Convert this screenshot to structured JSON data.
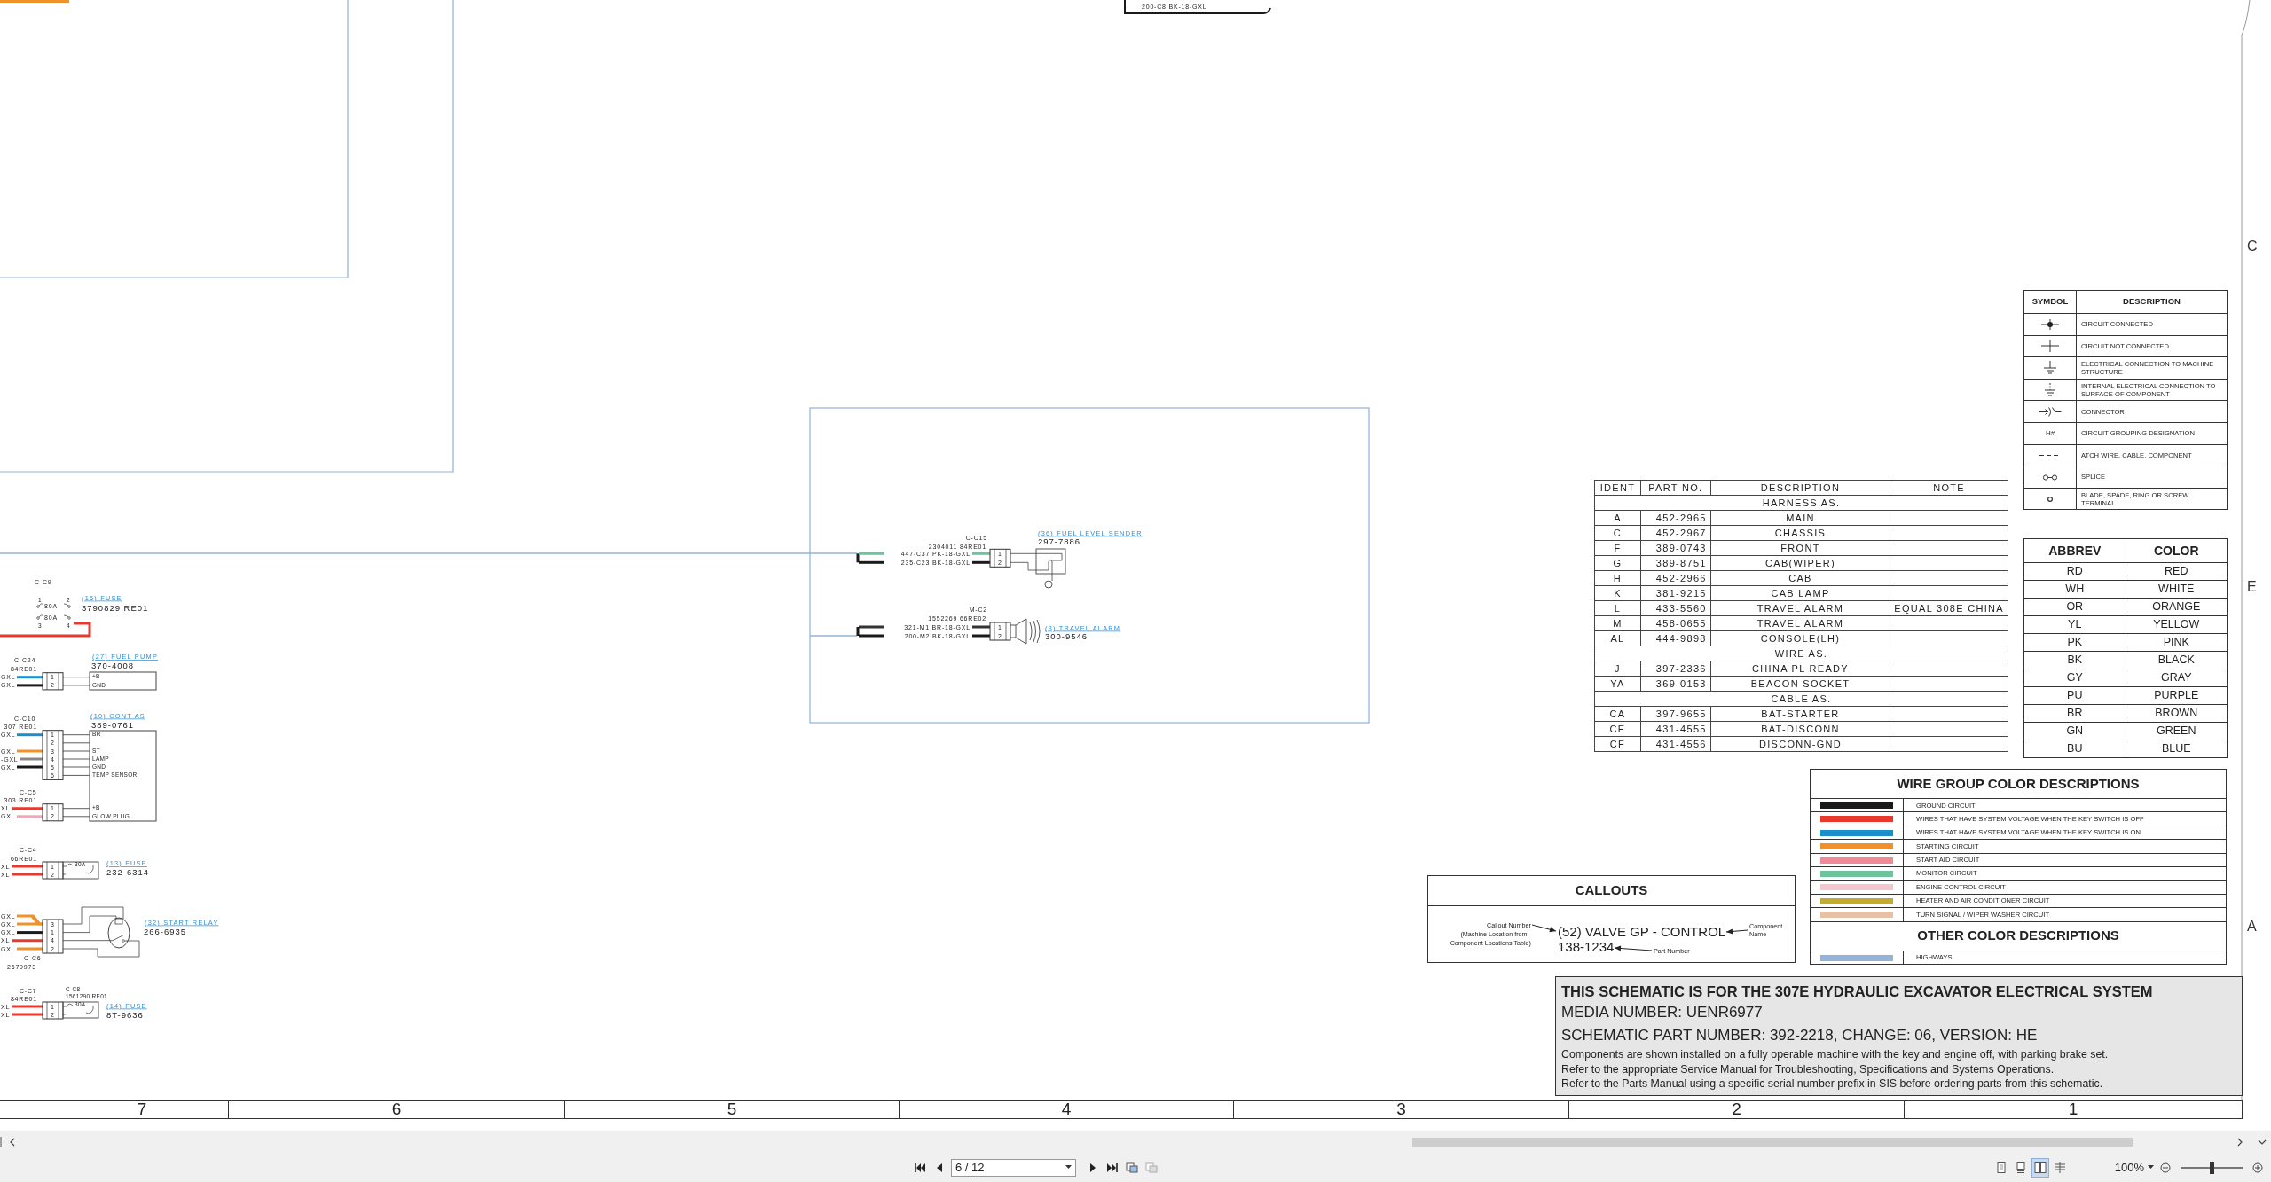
{
  "schematic": {
    "top_wire_label": "200-C8 BK-18-GXL",
    "components": [
      {
        "kind": "fuse_pair",
        "connector": "C-C9",
        "pins": [
          "1",
          "2",
          "3",
          "4"
        ],
        "ratings": [
          "80A",
          "80A"
        ],
        "color": "#e8392c",
        "callout": "(15) FUSE",
        "part": "3790829 RE01"
      },
      {
        "kind": "module",
        "connectors": [
          {
            "id": "C-C24",
            "ref": "84RE01",
            "pins": [
              {
                "n": "1",
                "wire": "GXL",
                "color": "#1a8fc9",
                "function": "+B"
              },
              {
                "n": "2",
                "wire": "GXL",
                "color": "#1a1a1a",
                "function": "GND"
              }
            ]
          }
        ],
        "callout": "(27) FUEL PUMP",
        "part": "370-4008"
      },
      {
        "kind": "module",
        "connectors": [
          {
            "id": "C-C10",
            "ref": "307 RE01",
            "pins": [
              {
                "n": "1",
                "wire": "GXL",
                "color": "#1a8fc9",
                "function": "BR"
              },
              {
                "n": "2"
              },
              {
                "n": "3",
                "wire": "GXL",
                "color": "#f0912a",
                "function": "ST"
              },
              {
                "n": "4",
                "wire": "-GXL",
                "color": "#888888",
                "function": "LAMP"
              },
              {
                "n": "5",
                "wire": "GXL",
                "color": "#1a1a1a",
                "function": "GND"
              },
              {
                "n": "6",
                "function": "TEMP SENSOR"
              }
            ]
          },
          {
            "id": "C-C5",
            "ref": "303 RE01",
            "pins": [
              {
                "n": "1",
                "wire": "XL",
                "color": "#e8392c",
                "function": "+B"
              },
              {
                "n": "2",
                "wire": "GXL",
                "color": "#f3a7b4",
                "function": "GLOW PLUG"
              }
            ]
          }
        ],
        "callout": "(10) CONT AS",
        "part": "389-0761"
      },
      {
        "kind": "fuse",
        "connector": "C-C4",
        "ref": "66RE01",
        "pins": [
          {
            "n": "1",
            "wire": "XL",
            "color": "#e8392c"
          },
          {
            "n": "2",
            "wire": "XL",
            "color": "#e8392c"
          }
        ],
        "rating": "30A",
        "callout": "(13) FUSE",
        "part": "232-6314"
      },
      {
        "kind": "relay",
        "connector": "C-C6",
        "ref": "2679973",
        "wires": [
          {
            "label": "GXL",
            "color": "#f0912a"
          },
          {
            "label": "GXL",
            "color": "#f0912a"
          },
          {
            "label": "GXL",
            "color": "#1a1a1a"
          },
          {
            "label": "XL",
            "color": "#e8392c"
          },
          {
            "label": "GXL",
            "color": "#f0912a"
          }
        ],
        "pins": [
          "3",
          "1",
          "4",
          "2"
        ],
        "callout": "(32) START RELAY",
        "part": "266-6935"
      },
      {
        "kind": "fuse",
        "connector": "C-C7",
        "ref": "84RE01",
        "pins": [
          {
            "n": "1",
            "wire": "XL",
            "color": "#e8392c"
          },
          {
            "n": "2",
            "wire": "XL",
            "color": "#e8392c"
          }
        ],
        "rating": "30A",
        "plug": "C-C8",
        "plug_ref": "1561290 RE01",
        "callout": "(14) FUSE",
        "part": "8T-9636"
      },
      {
        "kind": "sender",
        "connector": "C-C15",
        "ref": "2304011 84RE01",
        "pins": [
          {
            "n": "1",
            "wire": "447-C37 PK-18-GXL",
            "color": "#6dc39b"
          },
          {
            "n": "2",
            "wire": "235-C23 BK-18-GXL",
            "color": "#1a1a1a"
          }
        ],
        "callout": "(36) FUEL LEVEL SENDER",
        "part": "297-7886"
      },
      {
        "kind": "alarm",
        "connector": "M-C2",
        "ref": "1552269 66RE02",
        "pins": [
          {
            "n": "1",
            "wire": "321-M1 BR-18-GXL",
            "color": "#333333"
          },
          {
            "n": "2",
            "wire": "200-M2 BK-18-GXL",
            "color": "#1a1a1a"
          }
        ],
        "callout": "(3) TRAVEL ALARM",
        "part": "300-9546"
      }
    ]
  },
  "parts_table": {
    "columns": [
      "IDENT",
      "PART NO.",
      "DESCRIPTION",
      "NOTE"
    ],
    "rows": [
      {
        "kind": "section",
        "title": "HARNESS AS."
      },
      {
        "kind": "part",
        "ident": "A",
        "part_no": "452-2965",
        "description": "MAIN"
      },
      {
        "kind": "part",
        "ident": "C",
        "part_no": "452-2967",
        "description": "CHASSIS"
      },
      {
        "kind": "part",
        "ident": "F",
        "part_no": "389-0743",
        "description": "FRONT"
      },
      {
        "kind": "part",
        "ident": "G",
        "part_no": "389-8751",
        "description": "CAB(WIPER)"
      },
      {
        "kind": "part",
        "ident": "H",
        "part_no": "452-2966",
        "description": "CAB"
      },
      {
        "kind": "part",
        "ident": "K",
        "part_no": "381-9215",
        "description": "CAB LAMP"
      },
      {
        "kind": "part",
        "ident": "L",
        "part_no": "433-5560",
        "description": "TRAVEL ALARM",
        "note": "EQUAL 308E CHINA"
      },
      {
        "kind": "part",
        "ident": "M",
        "part_no": "458-0655",
        "description": "TRAVEL ALARM"
      },
      {
        "kind": "part",
        "ident": "AL",
        "part_no": "444-9898",
        "description": "CONSOLE(LH)"
      },
      {
        "kind": "section",
        "title": "WIRE AS."
      },
      {
        "kind": "part",
        "ident": "J",
        "part_no": "397-2336",
        "description": "CHINA PL READY"
      },
      {
        "kind": "part",
        "ident": "YA",
        "part_no": "369-0153",
        "description": "BEACON SOCKET"
      },
      {
        "kind": "section",
        "title": "CABLE AS."
      },
      {
        "kind": "part",
        "ident": "CA",
        "part_no": "397-9655",
        "description": "BAT-STARTER"
      },
      {
        "kind": "part",
        "ident": "CE",
        "part_no": "431-4555",
        "description": "BAT-DISCONN"
      },
      {
        "kind": "part",
        "ident": "CF",
        "part_no": "431-4556",
        "description": "DISCONN-GND"
      }
    ]
  },
  "symbol_table": {
    "columns": [
      "SYMBOL",
      "DESCRIPTION"
    ],
    "rows": [
      {
        "kind": "connected",
        "description": "CIRCUIT CONNECTED"
      },
      {
        "kind": "crossing",
        "description": "CIRCUIT NOT CONNECTED"
      },
      {
        "kind": "ground",
        "description": "ELECTRICAL CONNECTION TO MACHINE STRUCTURE"
      },
      {
        "kind": "internal_ground",
        "description": "INTERNAL ELECTRICAL CONNECTION TO SURFACE OF COMPONENT"
      },
      {
        "kind": "connector",
        "description": "CONNECTOR"
      },
      {
        "kind": "grouping",
        "symbol": "H#",
        "description": "CIRCUIT GROUPING DESIGNATION"
      },
      {
        "kind": "dashed",
        "description": "ATCH WIRE, CABLE, COMPONENT"
      },
      {
        "kind": "splice",
        "description": "SPLICE"
      },
      {
        "kind": "terminal",
        "description": "BLADE, SPADE, RING OR SCREW TERMINAL"
      }
    ]
  },
  "abbrev_table": {
    "columns": [
      "ABBREV",
      "COLOR"
    ],
    "rows": [
      {
        "abbrev": "RD",
        "color_name": "RED"
      },
      {
        "abbrev": "WH",
        "color_name": "WHITE"
      },
      {
        "abbrev": "OR",
        "color_name": "ORANGE"
      },
      {
        "abbrev": "YL",
        "color_name": "YELLOW"
      },
      {
        "abbrev": "PK",
        "color_name": "PINK"
      },
      {
        "abbrev": "BK",
        "color_name": "BLACK"
      },
      {
        "abbrev": "GY",
        "color_name": "GRAY"
      },
      {
        "abbrev": "PU",
        "color_name": "PURPLE"
      },
      {
        "abbrev": "BR",
        "color_name": "BROWN"
      },
      {
        "abbrev": "GN",
        "color_name": "GREEN"
      },
      {
        "abbrev": "BU",
        "color_name": "BLUE"
      }
    ]
  },
  "wire_groups": {
    "title": "WIRE GROUP COLOR DESCRIPTIONS",
    "items": [
      {
        "color": "#1a1a1a",
        "label": "GROUND CIRCUIT"
      },
      {
        "color": "#e8392c",
        "label": "WIRES THAT HAVE SYSTEM VOLTAGE WHEN THE KEY SWITCH IS OFF"
      },
      {
        "color": "#1a8fc9",
        "label": "WIRES THAT HAVE SYSTEM VOLTAGE WHEN THE KEY SWITCH IS ON"
      },
      {
        "color": "#f0912a",
        "label": "STARTING CIRCUIT"
      },
      {
        "color": "#f08a96",
        "label": "START AID CIRCUIT"
      },
      {
        "color": "#6dc39b",
        "label": "MONITOR CIRCUIT"
      },
      {
        "color": "#f3c7cd",
        "label": "ENGINE CONTROL CIRCUIT"
      },
      {
        "color": "#c2ab33",
        "label": "HEATER AND AIR CONDITIONER CIRCUIT"
      },
      {
        "color": "#e7c1a6",
        "label": "TURN SIGNAL / WIPER WASHER CIRCUIT"
      }
    ],
    "other_title": "OTHER COLOR DESCRIPTIONS",
    "other_items": [
      {
        "color": "#95b3d7",
        "label": "HIGHWAYS"
      }
    ]
  },
  "callouts": {
    "title": "CALLOUTS",
    "callout_note": [
      "Callout Number",
      "(Machine Location from",
      "Component Locations Table)"
    ],
    "example_name": "(52) VALVE GP - CONTROL",
    "example_part": "138-1234",
    "component_note": [
      "Component",
      "Name"
    ],
    "part_note": "Part Number"
  },
  "info": {
    "title": "THIS SCHEMATIC IS FOR THE 307E HYDRAULIC EXCAVATOR ELECTRICAL SYSTEM",
    "large_lines": [
      "MEDIA NUMBER: UENR6977",
      "SCHEMATIC PART NUMBER: 392-2218, CHANGE: 06, VERSION: HE"
    ],
    "small_lines": [
      "Components are shown installed on a fully operable machine with the key and engine off, with parking brake set.",
      "Refer to the appropriate Service Manual for Troubleshooting, Specifications and Systems Operations.",
      "Refer to the Parts Manual using a specific serial number prefix in SIS before ordering parts from this schematic."
    ]
  },
  "zones": [
    "7",
    "6",
    "5",
    "4",
    "3",
    "2",
    "1"
  ],
  "zone_letters": [
    "C",
    "E",
    "A"
  ],
  "viewer": {
    "page": "6 / 12",
    "zoom": "100%",
    "view_modes": [
      {
        "selected": false
      },
      {
        "selected": false
      },
      {
        "selected": true
      },
      {
        "selected": false
      }
    ],
    "zoom_slider": {
      "level": 0.5
    }
  }
}
